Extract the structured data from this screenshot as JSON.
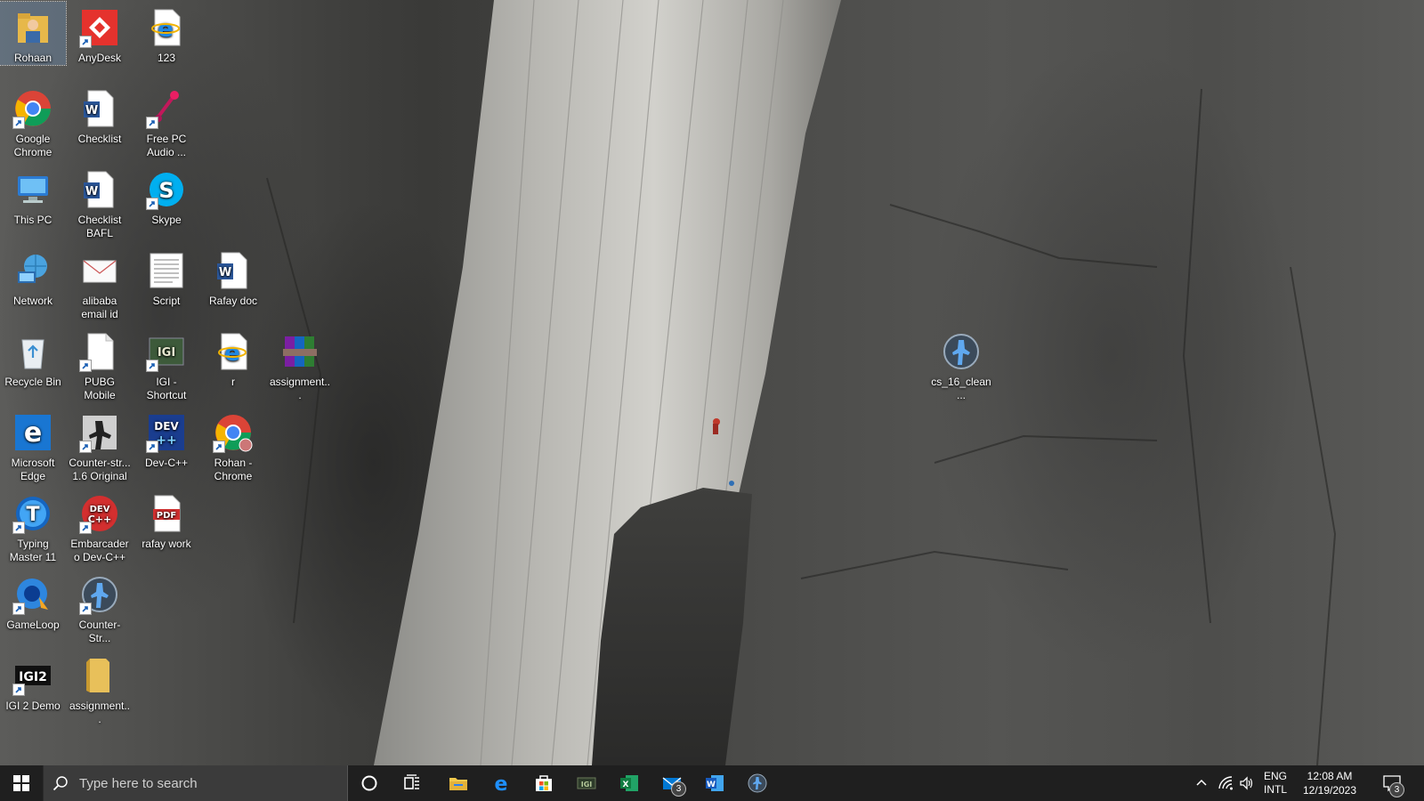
{
  "desktop": {
    "icons": [
      {
        "label": "Rohaan",
        "icon": "user-folder-icon",
        "selected": true
      },
      {
        "label": "AnyDesk",
        "icon": "anydesk-icon"
      },
      {
        "label": "123",
        "icon": "internet-explorer-icon"
      },
      {
        "label": "Google Chrome",
        "icon": "chrome-icon"
      },
      {
        "label": "Checklist",
        "icon": "word-document-icon"
      },
      {
        "label": "Free PC Audio ...",
        "icon": "audio-app-icon"
      },
      {
        "label": "This PC",
        "icon": "computer-icon"
      },
      {
        "label": "Checklist BAFL",
        "icon": "word-document-icon"
      },
      {
        "label": "Skype",
        "icon": "skype-icon"
      },
      {
        "label": "Network",
        "icon": "network-icon"
      },
      {
        "label": "alibaba email id",
        "icon": "email-document-icon"
      },
      {
        "label": "Script",
        "icon": "text-document-icon"
      },
      {
        "label": "Rafay doc",
        "icon": "word-document-icon"
      },
      {
        "label": "Recycle Bin",
        "icon": "recycle-bin-icon"
      },
      {
        "label": "PUBG Mobile",
        "icon": "blank-file-icon"
      },
      {
        "label": "IGI - Shortcut",
        "icon": "igi-game-icon"
      },
      {
        "label": "r",
        "icon": "internet-explorer-icon"
      },
      {
        "label": "assignment...",
        "icon": "winrar-archive-icon"
      },
      {
        "label": "Microsoft Edge",
        "icon": "edge-icon"
      },
      {
        "label": "Counter-str... 1.6 Original",
        "icon": "counter-strike-icon"
      },
      {
        "label": "Dev-C++",
        "icon": "dev-cpp-icon"
      },
      {
        "label": "Rohan - Chrome",
        "icon": "chrome-profile-icon"
      },
      {
        "label": "Typing Master 11",
        "icon": "typing-master-icon"
      },
      {
        "label": "Embarcadero Dev-C++",
        "icon": "embarcadero-devcpp-icon"
      },
      {
        "label": "rafay work",
        "icon": "pdf-icon"
      },
      {
        "label": "GameLoop",
        "icon": "gameloop-icon"
      },
      {
        "label": "Counter-Str...",
        "icon": "counter-strike-icon"
      },
      {
        "label": "IGI 2 Demo",
        "icon": "igi2-icon"
      },
      {
        "label": "assignment...",
        "icon": "folder-icon"
      },
      {
        "label": "cs_16_clean...",
        "icon": "counter-strike-icon"
      }
    ]
  },
  "taskbar": {
    "search_placeholder": "Type here to search",
    "pinned": [
      {
        "name": "cortana-icon"
      },
      {
        "name": "task-view-icon"
      },
      {
        "name": "file-explorer-icon"
      },
      {
        "name": "edge-icon"
      },
      {
        "name": "microsoft-store-icon"
      },
      {
        "name": "game-icon"
      },
      {
        "name": "excel-icon"
      },
      {
        "name": "mail-icon",
        "badge": "3"
      },
      {
        "name": "word-icon"
      },
      {
        "name": "counter-strike-icon"
      }
    ],
    "tray": {
      "lang_line1": "ENG",
      "lang_line2": "INTL",
      "time": "12:08 AM",
      "date": "12/19/2023",
      "notifications_count": "3"
    }
  }
}
